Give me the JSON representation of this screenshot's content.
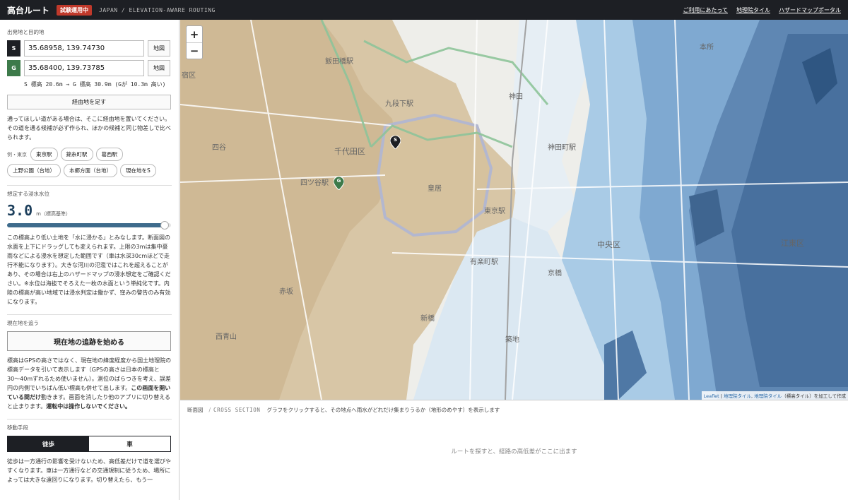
{
  "header": {
    "brand": "高台ルート",
    "badge": "試験運用中",
    "subtitle": "JAPAN / ELEVATION-AWARE ROUTING",
    "links": [
      "ご利用にあたって",
      "地理院タイル",
      "ハザードマップポータル"
    ]
  },
  "sidebar": {
    "od_section": "出発地と目的地",
    "start": {
      "badge": "S",
      "value": "35.68958, 139.74730",
      "map_button": "地図"
    },
    "goal": {
      "badge": "G",
      "value": "35.68400, 139.73785",
      "map_button": "地図"
    },
    "elevation_info": "S 標高 20.6m → G 標高 30.9m (Gが 10.3m 高い)",
    "add_waypoint": "経由地を足す",
    "waypoint_note": "通ってほしい道がある場合は、そこに経由地を置いてください。その道を通る候補が必ず作られ、ほかの候補と同じ物差しで比べられます。",
    "preset_label": "例・東京",
    "presets": [
      "東京駅",
      "錦糸町駅",
      "葛西駅",
      "上野公園（台地）",
      "本郷方面（台地）",
      "現在地をS"
    ],
    "flood_section": "想定する浸水水位",
    "flood_value": "3.0",
    "flood_unit": "m（標高基準）",
    "flood_fraction": 0.96,
    "flood_note": "この標高より低い土地を「水に浸かる」とみなします。断面図の水面を上下にドラッグしても変えられます。上限の3mは集中豪雨などによる浸水を想定した範囲です（車は水深30cmほどで走行不能になります）。大きな河川の氾濫ではこれを超えることがあり、その場合は右上のハザードマップの浸水想定をご確認ください。※水位は海抜でそろえた一枚の水面という単純化です。内陸の標高が高い地域では浸水判定は働かず、窪みの警告のみ有効になります。",
    "tracking_section": "現在地を追う",
    "tracking_button": "現在地の追跡を始める",
    "tracking_note_1": "標高はGPSの高さではなく、現在地の緯度経度から国土地理院の標高データを引いて表示します（GPSの高さは日本の標高と30〜40mずれるため使いません）。測位のばらつきを考え、誤差円の内側でいちばん低い標高も併せて出します。",
    "tracking_note_bold_1": "この画面を開いている間だけ",
    "tracking_note_2": "動きます。画面を消したり他のアプリに切り替えると止まります。",
    "tracking_note_bold_2": "運転中は操作しないでください。",
    "mode_section": "移動手段",
    "modes": {
      "walk": "徒歩",
      "car": "車",
      "selected": "walk"
    },
    "mode_note": "徒歩は一方通行の影響を受けないため、高低差だけで道を選びやすくなります。車は一方通行などの交通規制に従うため、場所によっては大きな遠回りになります。切り替えたら、もう一"
  },
  "map": {
    "zoom_in": "+",
    "zoom_out": "−",
    "labels": [
      "宿区",
      "飯田橋駅",
      "九段下駅",
      "神田",
      "千代田区",
      "四谷",
      "四ツ谷駅",
      "皇居",
      "赤坂",
      "新橋",
      "中央区",
      "江東区",
      "神田町駅",
      "築地",
      "西青山",
      "東京駅",
      "有楽町駅",
      "京橋",
      "本所"
    ],
    "start_marker": "S",
    "goal_marker": "G",
    "attribution": {
      "leaflet": "Leaflet",
      "gsi_1": "地理院タイル",
      "gsi_2": "地理院タイル",
      "suffix": "（標高タイル）を加工して作成"
    }
  },
  "cross_section": {
    "title": "断面図",
    "separator": "/",
    "title_en": "CROSS SECTION",
    "hint": "グラフをクリックすると、その地点へ雨水がどれだけ集まりうるか（地形のめやす）を表示します",
    "empty": "ルートを探すと、経路の高低差がここに出ます"
  }
}
